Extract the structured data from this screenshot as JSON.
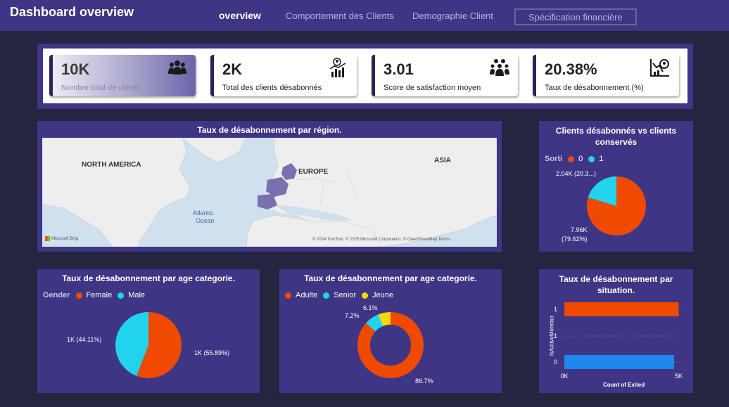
{
  "header": {
    "title": "Dashboard overview",
    "tabs": [
      "overview",
      "Comportement des Clients",
      "Demographie Client",
      "Spécification financière"
    ]
  },
  "kpis": [
    {
      "value": "10K",
      "label": "Nombre total de clients",
      "icon": "people-icon"
    },
    {
      "value": "2K",
      "label": "Total des clients désabonnés",
      "icon": "user-chart-icon"
    },
    {
      "value": "3.01",
      "label": "Score de satisfaction moyen",
      "icon": "group-icon"
    },
    {
      "value": "20.38%",
      "label": "Taux de désabonnement (%)",
      "icon": "churn-chart-icon"
    }
  ],
  "map_panel": {
    "title": "Taux de désabonnement par région.",
    "labels": [
      "NORTH AMERICA",
      "EUROPE",
      "ASIA",
      "Atlantic",
      "Ocean"
    ],
    "attribution": "© 2024 TomTom, © 2025 Microsoft Corporation, © OpenStreetMap  Terms",
    "logo": "Microsoft Bing"
  },
  "exited_panel": {
    "title_line1": "Clients désabonnés vs clients",
    "title_line2": "conservés",
    "legend_key": "Sorti",
    "legend": [
      "0",
      "1"
    ],
    "label_small_1": "2.04K (20.3...)",
    "label_large_1": "7.96K",
    "label_large_2": "(79.62%)",
    "chart_data": {
      "type": "pie",
      "categories": [
        "0",
        "1"
      ],
      "values": [
        7.96,
        2.04
      ],
      "labels": [
        "7.96K (79.62%)",
        "2.04K (20.3...)"
      ],
      "colors": [
        "#f04a00",
        "#22d3ee"
      ]
    }
  },
  "gender_panel": {
    "title": "Taux de désabonnement par age categorie.",
    "legend_key": "Gender",
    "legend": [
      "Female",
      "Male"
    ],
    "label_female": "1K (55.89%)",
    "label_male": "1K (44.11%)",
    "chart_data": {
      "type": "pie",
      "categories": [
        "Female",
        "Male"
      ],
      "values": [
        55.89,
        44.11
      ],
      "colors": [
        "#f04a00",
        "#22d3ee"
      ]
    }
  },
  "age_panel": {
    "title": "Taux de désabonnement par age categorie.",
    "legend": [
      "Adulte",
      "Senior",
      "Jeune"
    ],
    "label_adulte": "86.7%",
    "label_senior": "7.2%",
    "label_jeune": "6.1%",
    "chart_data": {
      "type": "pie",
      "categories": [
        "Adulte",
        "Senior",
        "Jeune"
      ],
      "values": [
        86.7,
        7.2,
        6.1
      ],
      "colors": [
        "#f04a00",
        "#22d3ee",
        "#f5d90a"
      ]
    }
  },
  "situation_panel": {
    "title_line1": "Taux de désabonnement par",
    "title_line2": "situation.",
    "y_axis_label": "IsActiveMember",
    "x_axis_label": "Count of Exited",
    "x_ticks": [
      "0K",
      "5K"
    ],
    "y_ticks": [
      "1",
      "1",
      "0"
    ],
    "chart_data": {
      "type": "bar",
      "orientation": "horizontal",
      "categories": [
        "1",
        "0"
      ],
      "values": [
        5.0,
        4.8
      ],
      "xlim": [
        0,
        5.2
      ],
      "colors": [
        "#f04a00",
        "#1e88f0"
      ],
      "xlabel": "Count of Exited",
      "ylabel": "IsActiveMember"
    }
  },
  "colors": {
    "background": "#252441",
    "panel": "#3e3584",
    "orange": "#f04a00",
    "cyan": "#22d3ee",
    "yellow": "#f5d90a",
    "blue": "#1e88f0"
  }
}
